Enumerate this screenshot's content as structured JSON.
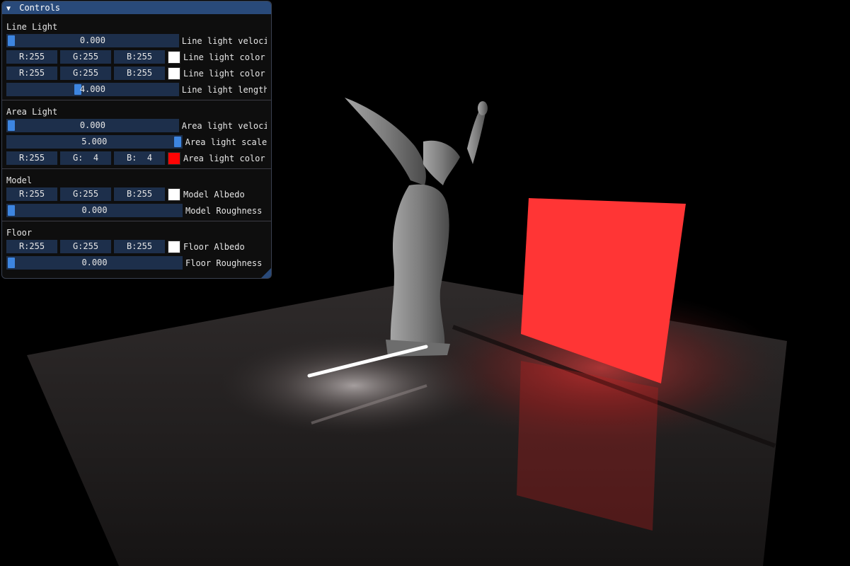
{
  "window": {
    "title": "Controls",
    "sections": [
      {
        "title": "Line Light",
        "rows": [
          {
            "kind": "slider",
            "value": "0.000",
            "fraction": 0.0,
            "label": "Line light veloci"
          },
          {
            "kind": "color",
            "r": "R:255",
            "g": "G:255",
            "b": "B:255",
            "swatch": "#ffffff",
            "label": "Line light color"
          },
          {
            "kind": "color",
            "r": "R:255",
            "g": "G:255",
            "b": "B:255",
            "swatch": "#ffffff",
            "label": "Line light color"
          },
          {
            "kind": "slider",
            "value": "4.000",
            "fraction": 0.4,
            "label": "Line light length"
          }
        ]
      },
      {
        "title": "Area Light",
        "rows": [
          {
            "kind": "slider",
            "value": "0.000",
            "fraction": 0.0,
            "label": "Area light veloci"
          },
          {
            "kind": "slider",
            "value": "5.000",
            "fraction": 1.0,
            "label": "Area light scale"
          },
          {
            "kind": "color",
            "r": "R:255",
            "g": "G:  4",
            "b": "B:  4",
            "swatch": "#ff0404",
            "label": "Area light color"
          }
        ]
      },
      {
        "title": "Model",
        "rows": [
          {
            "kind": "color",
            "r": "R:255",
            "g": "G:255",
            "b": "B:255",
            "swatch": "#ffffff",
            "label": "Model Albedo"
          },
          {
            "kind": "slider",
            "value": "0.000",
            "fraction": 0.0,
            "label": "Model Roughness"
          }
        ]
      },
      {
        "title": "Floor",
        "rows": [
          {
            "kind": "color",
            "r": "R:255",
            "g": "G:255",
            "b": "B:255",
            "swatch": "#ffffff",
            "label": "Floor Albedo"
          },
          {
            "kind": "slider",
            "value": "0.000",
            "fraction": 0.0,
            "label": "Floor Roughness"
          }
        ]
      }
    ]
  },
  "colors": {
    "background": "#000000",
    "title_bar": "#294a7a",
    "frame": "#1d2f4b",
    "slider_grab": "#3d85e0",
    "area_light": "#ff3333",
    "line_light": "#ffffff",
    "floor": "#3a3433",
    "statue": "#8a8a8a"
  }
}
